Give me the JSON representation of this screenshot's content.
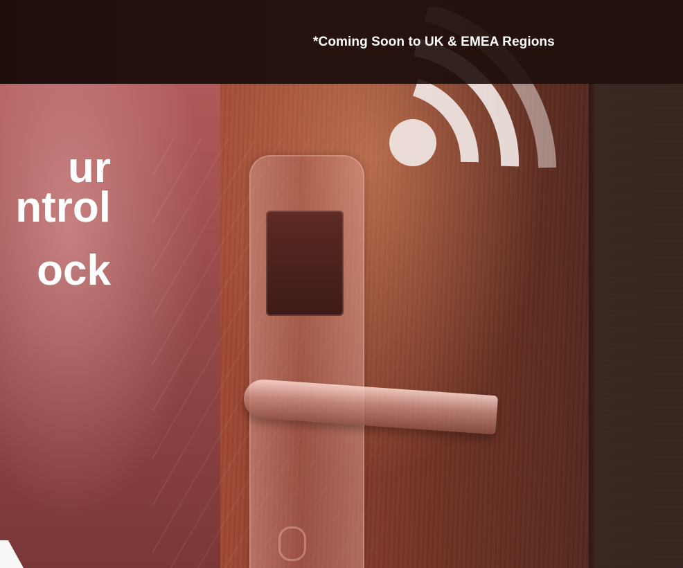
{
  "banner": {
    "notice_text": "*Coming Soon to UK & EMEA Regions",
    "headline_lines": [
      "ur",
      "ntrol",
      "ock"
    ]
  },
  "icons": {
    "wifi": "wifi-icon"
  },
  "colors": {
    "notice_text": "#ffffff",
    "headline_text": "#ffffff",
    "top_bar": "#1e0f0c",
    "accent_overlay": "#913d3d"
  }
}
